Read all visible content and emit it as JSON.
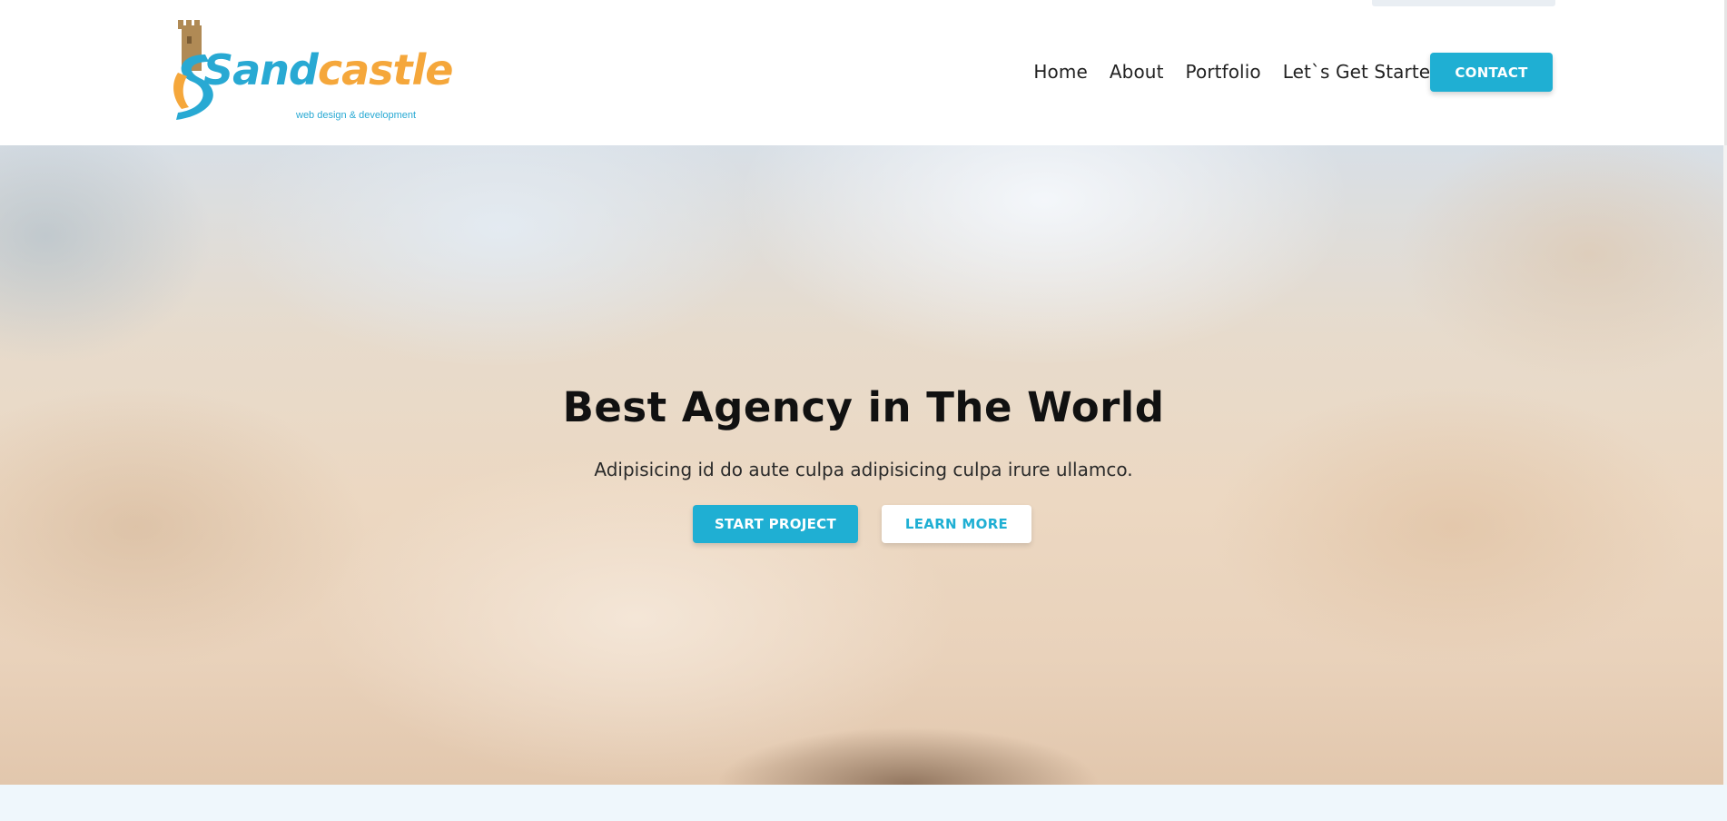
{
  "header": {
    "logo": {
      "name_part1": "Sand",
      "name_part2": "castle",
      "tagline": "web design & development",
      "colors": {
        "blue": "#28a9d3",
        "orange": "#f5a73b",
        "tower": "#b08a55"
      }
    },
    "nav": {
      "items": [
        {
          "label": "Home"
        },
        {
          "label": "About"
        },
        {
          "label": "Portfolio"
        },
        {
          "label": "Let`s Get Started"
        }
      ],
      "contact_label": "CONTACT"
    }
  },
  "hero": {
    "title": "Best Agency in The World",
    "subtitle": "Adipisicing id do aute culpa adipisicing culpa irure ullamco.",
    "primary_button": "START PROJECT",
    "secondary_button": "LEARN MORE"
  },
  "theme": {
    "accent": "#1fafd3",
    "text_dark": "#111111",
    "section_bg": "#eff7fc"
  }
}
